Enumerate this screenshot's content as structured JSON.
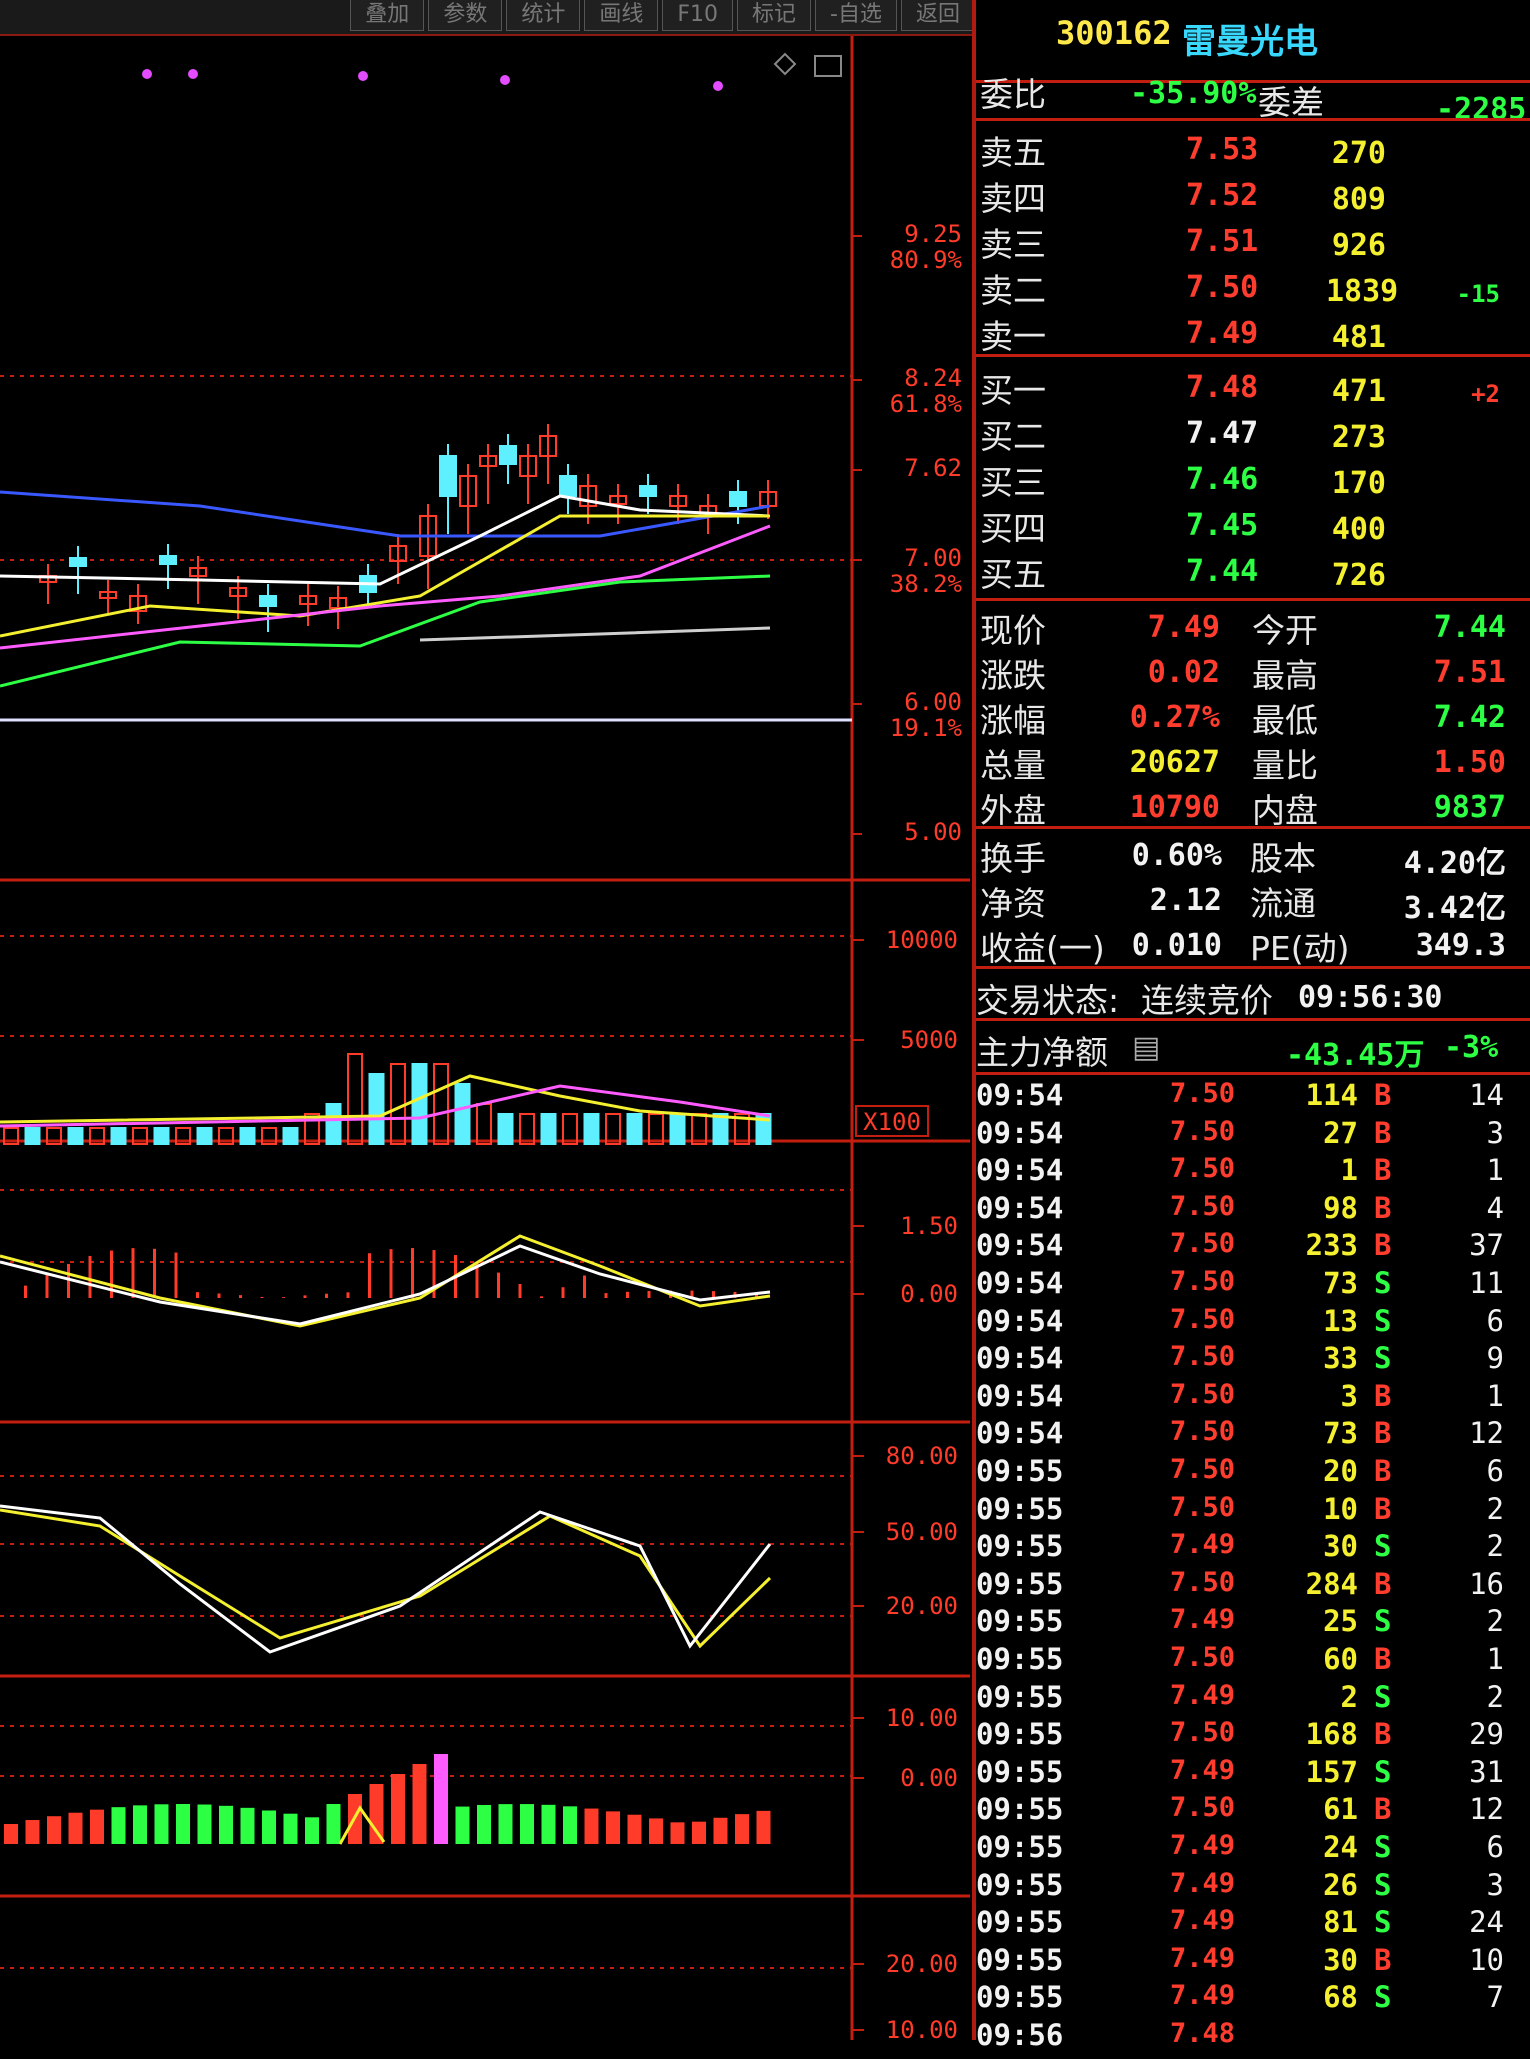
{
  "toolbar": {
    "buttons": [
      "叠加",
      "参数",
      "统计",
      "画线",
      "F10",
      "标记",
      "-自选",
      "返回"
    ]
  },
  "chart": {
    "main_axis": [
      {
        "value": "9.25",
        "pct": "80.9%"
      },
      {
        "value": "8.24",
        "pct": "61.8%"
      },
      {
        "value": "7.62",
        "pct": ""
      },
      {
        "value": "7.00",
        "pct": "38.2%"
      },
      {
        "value": "6.00",
        "pct": "19.1%"
      },
      {
        "value": "5.00",
        "pct": ""
      }
    ],
    "volume_axis": [
      "10000",
      "5000"
    ],
    "volume_unit": "X100",
    "macd_axis": [
      "1.50",
      "0.00"
    ],
    "kdj_axis": [
      "80.00",
      "50.00",
      "20.00"
    ],
    "ind4_axis": [
      "10.00",
      "0.00"
    ],
    "ind5_axis": [
      "20.00",
      "10.00"
    ],
    "colors": {
      "up": "#ff3b2a",
      "down": "#5ff0ff",
      "ma5": "#ffffff",
      "ma10": "#f4f030",
      "ma20": "#ff5cff",
      "ma60": "#2dff45",
      "ma120": "#3a58ff"
    }
  },
  "quote": {
    "code": "300162",
    "name": "雷曼光电",
    "ratio_label": "委比",
    "ratio_value": "-35.90%",
    "diff_label": "委差",
    "diff_value": "-2285",
    "asks": [
      {
        "label": "卖五",
        "price": "7.53",
        "vol": "270",
        "chg": ""
      },
      {
        "label": "卖四",
        "price": "7.52",
        "vol": "809",
        "chg": ""
      },
      {
        "label": "卖三",
        "price": "7.51",
        "vol": "926",
        "chg": ""
      },
      {
        "label": "卖二",
        "price": "7.50",
        "vol": "1839",
        "chg": "-15"
      },
      {
        "label": "卖一",
        "price": "7.49",
        "vol": "481",
        "chg": ""
      }
    ],
    "bids": [
      {
        "label": "买一",
        "price": "7.48",
        "vol": "471",
        "chg": "+2"
      },
      {
        "label": "买二",
        "price": "7.47",
        "vol": "273",
        "chg": ""
      },
      {
        "label": "买三",
        "price": "7.46",
        "vol": "170",
        "chg": ""
      },
      {
        "label": "买四",
        "price": "7.45",
        "vol": "400",
        "chg": ""
      },
      {
        "label": "买五",
        "price": "7.44",
        "vol": "726",
        "chg": ""
      }
    ],
    "stats": [
      {
        "l1": "现价",
        "v1": "7.49",
        "l2": "今开",
        "v2": "7.44",
        "c1": "red",
        "c2": "grn"
      },
      {
        "l1": "涨跌",
        "v1": "0.02",
        "l2": "最高",
        "v2": "7.51",
        "c1": "red",
        "c2": "red"
      },
      {
        "l1": "涨幅",
        "v1": "0.27%",
        "l2": "最低",
        "v2": "7.42",
        "c1": "red",
        "c2": "grn"
      },
      {
        "l1": "总量",
        "v1": "20627",
        "l2": "量比",
        "v2": "1.50",
        "c1": "yel",
        "c2": "red"
      },
      {
        "l1": "外盘",
        "v1": "10790",
        "l2": "内盘",
        "v2": "9837",
        "c1": "red",
        "c2": "grn"
      }
    ],
    "fund": [
      {
        "l1": "换手",
        "v1": "0.60%",
        "l2": "股本",
        "v2": "4.20亿"
      },
      {
        "l1": "净资",
        "v1": "2.12",
        "l2": "流通",
        "v2": "3.42亿"
      },
      {
        "l1": "收益(一)",
        "v1": "0.010",
        "l2": "PE(动)",
        "v2": "349.3"
      }
    ],
    "status_label": "交易状态:",
    "status_value": "连续竞价",
    "status_time": "09:56:30",
    "main_net_label": "主力净额",
    "main_net_value": "-43.45万",
    "main_net_pct": "-3%"
  },
  "ticks": [
    {
      "t": "09:54",
      "p": "7.50",
      "v": "114",
      "d": "B",
      "n": "14"
    },
    {
      "t": "09:54",
      "p": "7.50",
      "v": "27",
      "d": "B",
      "n": "3"
    },
    {
      "t": "09:54",
      "p": "7.50",
      "v": "1",
      "d": "B",
      "n": "1"
    },
    {
      "t": "09:54",
      "p": "7.50",
      "v": "98",
      "d": "B",
      "n": "4"
    },
    {
      "t": "09:54",
      "p": "7.50",
      "v": "233",
      "d": "B",
      "n": "37"
    },
    {
      "t": "09:54",
      "p": "7.50",
      "v": "73",
      "d": "S",
      "n": "11"
    },
    {
      "t": "09:54",
      "p": "7.50",
      "v": "13",
      "d": "S",
      "n": "6"
    },
    {
      "t": "09:54",
      "p": "7.50",
      "v": "33",
      "d": "S",
      "n": "9"
    },
    {
      "t": "09:54",
      "p": "7.50",
      "v": "3",
      "d": "B",
      "n": "1"
    },
    {
      "t": "09:54",
      "p": "7.50",
      "v": "73",
      "d": "B",
      "n": "12"
    },
    {
      "t": "09:55",
      "p": "7.50",
      "v": "20",
      "d": "B",
      "n": "6"
    },
    {
      "t": "09:55",
      "p": "7.50",
      "v": "10",
      "d": "B",
      "n": "2"
    },
    {
      "t": "09:55",
      "p": "7.49",
      "v": "30",
      "d": "S",
      "n": "2"
    },
    {
      "t": "09:55",
      "p": "7.50",
      "v": "284",
      "d": "B",
      "n": "16"
    },
    {
      "t": "09:55",
      "p": "7.49",
      "v": "25",
      "d": "S",
      "n": "2"
    },
    {
      "t": "09:55",
      "p": "7.50",
      "v": "60",
      "d": "B",
      "n": "1"
    },
    {
      "t": "09:55",
      "p": "7.49",
      "v": "2",
      "d": "S",
      "n": "2"
    },
    {
      "t": "09:55",
      "p": "7.50",
      "v": "168",
      "d": "B",
      "n": "29"
    },
    {
      "t": "09:55",
      "p": "7.49",
      "v": "157",
      "d": "S",
      "n": "31"
    },
    {
      "t": "09:55",
      "p": "7.50",
      "v": "61",
      "d": "B",
      "n": "12"
    },
    {
      "t": "09:55",
      "p": "7.49",
      "v": "24",
      "d": "S",
      "n": "6"
    },
    {
      "t": "09:55",
      "p": "7.49",
      "v": "26",
      "d": "S",
      "n": "3"
    },
    {
      "t": "09:55",
      "p": "7.49",
      "v": "81",
      "d": "S",
      "n": "24"
    },
    {
      "t": "09:55",
      "p": "7.49",
      "v": "30",
      "d": "B",
      "n": "10"
    },
    {
      "t": "09:55",
      "p": "7.49",
      "v": "68",
      "d": "S",
      "n": "7"
    },
    {
      "t": "09:56",
      "p": "7.48",
      "v": "",
      "d": "",
      "n": ""
    }
  ]
}
